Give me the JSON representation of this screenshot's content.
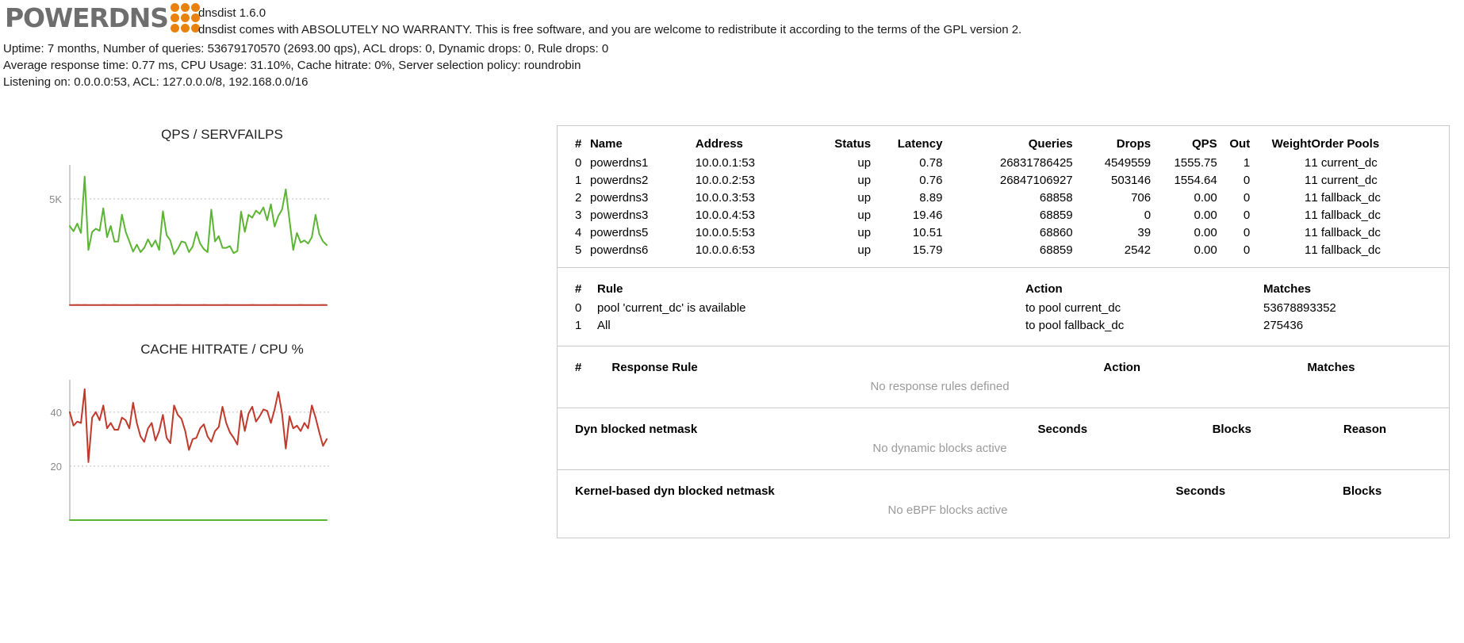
{
  "header": {
    "logo_text": "POWERDNS",
    "logo_dot_color": "#e8820c",
    "logo_text_color": "#6e6e6e",
    "version": "dnsdist 1.6.0",
    "warranty": "dnsdist comes with ABSOLUTELY NO WARRANTY. This is free software, and you are welcome to redistribute it according to the terms of the GPL version 2."
  },
  "stats": {
    "line1": "Uptime: 7 months, Number of queries: 53679170570 (2693.00 qps), ACL drops: 0, Dynamic drops: 0, Rule drops: 0",
    "line2": "Average response time: 0.77 ms, CPU Usage: 31.10%, Cache hitrate: 0%, Server selection policy: roundrobin",
    "line3": "Listening on: 0.0.0.0:53, ACL: 127.0.0.0/8, 192.168.0.0/16"
  },
  "charts": [
    {
      "title": "QPS / SERVFAILPS",
      "ytick_labels": [
        "5K"
      ]
    },
    {
      "title": "CACHE HITRATE / CPU %",
      "ytick_labels": [
        "40",
        "20"
      ]
    }
  ],
  "chart_data": [
    {
      "type": "line",
      "title": "QPS / SERVFAILPS",
      "xlabel": "",
      "ylabel": "",
      "ylim": [
        0,
        6600
      ],
      "yticks": [
        5000
      ],
      "ytick_labels": [
        "5K"
      ],
      "grid": true,
      "legend": "none",
      "series": [
        {
          "name": "QPS",
          "color": "#5cb433",
          "values": [
            3720,
            3480,
            3840,
            3400,
            6050,
            2600,
            3450,
            3600,
            3500,
            4560,
            3200,
            3730,
            2990,
            3000,
            4260,
            3460,
            3000,
            2520,
            2850,
            2500,
            2700,
            3100,
            2750,
            3050,
            2600,
            4420,
            3300,
            3050,
            2400,
            2650,
            3000,
            2950,
            2500,
            2760,
            3450,
            2900,
            2640,
            2500,
            4500,
            3000,
            3250,
            2700,
            2700,
            2780,
            2450,
            2550,
            4400,
            3450,
            4250,
            4120,
            4450,
            4300,
            4600,
            4000,
            4750,
            3700,
            4200,
            4500,
            5450,
            4000,
            2600,
            3400,
            2950,
            3050,
            2900,
            3200,
            4250,
            3350,
            3000,
            2830
          ]
        },
        {
          "name": "SERVFAILPS",
          "color": "#c0392b",
          "values": [
            10,
            8,
            12,
            9,
            14,
            7,
            11,
            9,
            8,
            13,
            10,
            9,
            12,
            8,
            11,
            10,
            9,
            8,
            12,
            9,
            11,
            10,
            9,
            12,
            8,
            10,
            11,
            9,
            8,
            12,
            10,
            9,
            11,
            8,
            10,
            9,
            12,
            8,
            11,
            10,
            9,
            8,
            12,
            10,
            9,
            11,
            8,
            10,
            9,
            12,
            8,
            11,
            10,
            9,
            8,
            12,
            10,
            9,
            11,
            8,
            10,
            9,
            12,
            8,
            11,
            10,
            9,
            8,
            12,
            10
          ]
        }
      ]
    },
    {
      "type": "line",
      "title": "CACHE HITRATE / CPU %",
      "xlabel": "",
      "ylabel": "",
      "ylim": [
        0,
        52
      ],
      "yticks": [
        40,
        20
      ],
      "ytick_labels": [
        "40",
        "20"
      ],
      "grid": true,
      "legend": "none",
      "series": [
        {
          "name": "CPU %",
          "color": "#c0392b",
          "values": [
            40,
            35,
            36.5,
            36,
            48.5,
            21.5,
            38,
            40,
            37,
            42.5,
            34,
            36,
            33.5,
            33.5,
            38,
            37,
            34,
            43.5,
            36,
            31,
            29,
            34,
            36,
            29.5,
            33,
            39,
            30.5,
            28.5,
            42.5,
            39,
            37.5,
            33,
            26,
            30,
            30.5,
            34,
            35.5,
            31,
            29,
            33,
            34.5,
            42,
            36,
            32.5,
            30.5,
            28,
            40.5,
            33,
            39.5,
            42,
            36.5,
            38.5,
            41,
            40.5,
            36,
            41,
            47.5,
            39.5,
            26.5,
            38.5,
            34,
            35,
            33,
            36,
            34,
            42.5,
            38,
            32.5,
            27.5,
            30
          ]
        },
        {
          "name": "CACHE HITRATE",
          "color": "#5cb433",
          "values": [
            0,
            0,
            0,
            0,
            0,
            0,
            0,
            0,
            0,
            0,
            0,
            0,
            0,
            0,
            0,
            0,
            0,
            0,
            0,
            0,
            0,
            0,
            0,
            0,
            0,
            0,
            0,
            0,
            0,
            0,
            0,
            0,
            0,
            0,
            0,
            0,
            0,
            0,
            0,
            0,
            0,
            0,
            0,
            0,
            0,
            0,
            0,
            0,
            0,
            0,
            0,
            0,
            0,
            0,
            0,
            0,
            0,
            0,
            0,
            0,
            0,
            0,
            0,
            0,
            0,
            0,
            0,
            0,
            0,
            0
          ]
        }
      ]
    }
  ],
  "servers": {
    "headers": [
      "#",
      "Name",
      "Address",
      "Status",
      "Latency",
      "Queries",
      "Drops",
      "QPS",
      "Out",
      "Weight",
      "Order",
      "Pools"
    ],
    "rows": [
      {
        "idx": "0",
        "name": "powerdns1",
        "address": "10.0.0.1:53",
        "status": "up",
        "latency": "0.78",
        "queries": "26831786425",
        "drops": "4549559",
        "qps": "1555.75",
        "out": "1",
        "weight": "1",
        "order": "1",
        "pools": "current_dc"
      },
      {
        "idx": "1",
        "name": "powerdns2",
        "address": "10.0.0.2:53",
        "status": "up",
        "latency": "0.76",
        "queries": "26847106927",
        "drops": "503146",
        "qps": "1554.64",
        "out": "0",
        "weight": "1",
        "order": "1",
        "pools": "current_dc"
      },
      {
        "idx": "2",
        "name": "powerdns3",
        "address": "10.0.0.3:53",
        "status": "up",
        "latency": "8.89",
        "queries": "68858",
        "drops": "706",
        "qps": "0.00",
        "out": "0",
        "weight": "1",
        "order": "1",
        "pools": "fallback_dc"
      },
      {
        "idx": "3",
        "name": "powerdns3",
        "address": "10.0.0.4:53",
        "status": "up",
        "latency": "19.46",
        "queries": "68859",
        "drops": "0",
        "qps": "0.00",
        "out": "0",
        "weight": "1",
        "order": "1",
        "pools": "fallback_dc"
      },
      {
        "idx": "4",
        "name": "powerdns5",
        "address": "10.0.0.5:53",
        "status": "up",
        "latency": "10.51",
        "queries": "68860",
        "drops": "39",
        "qps": "0.00",
        "out": "0",
        "weight": "1",
        "order": "1",
        "pools": "fallback_dc"
      },
      {
        "idx": "5",
        "name": "powerdns6",
        "address": "10.0.0.6:53",
        "status": "up",
        "latency": "15.79",
        "queries": "68859",
        "drops": "2542",
        "qps": "0.00",
        "out": "0",
        "weight": "1",
        "order": "1",
        "pools": "fallback_dc"
      }
    ]
  },
  "rules": {
    "headers": [
      "#",
      "Rule",
      "Action",
      "Matches"
    ],
    "rows": [
      {
        "idx": "0",
        "rule": "pool 'current_dc' is available",
        "action": "to pool current_dc",
        "matches": "53678893352"
      },
      {
        "idx": "1",
        "rule": "All",
        "action": "to pool fallback_dc",
        "matches": "275436"
      }
    ]
  },
  "response_rules": {
    "headers": [
      "#",
      "Response Rule",
      "Action",
      "Matches"
    ],
    "empty_text": "No response rules defined"
  },
  "dyn_blocks": {
    "headers": [
      "Dyn blocked netmask",
      "Seconds",
      "Blocks",
      "Reason"
    ],
    "empty_text": "No dynamic blocks active"
  },
  "ebpf_blocks": {
    "headers": [
      "Kernel-based dyn blocked netmask",
      "Seconds",
      "Blocks"
    ],
    "empty_text": "No eBPF blocks active"
  }
}
